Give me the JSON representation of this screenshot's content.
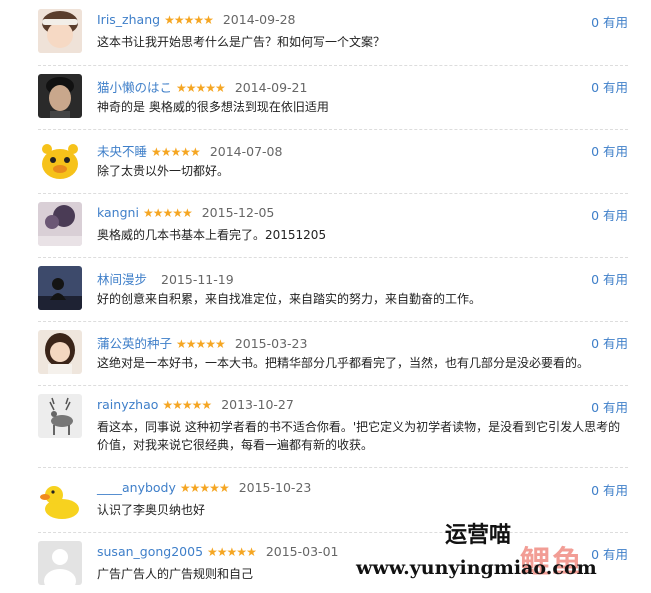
{
  "reviews": [
    {
      "user": "Iris_zhang",
      "stars": "★★★★★",
      "date": "2014-09-28",
      "useful": "0 有用",
      "text": "这本书让我开始思考什么是广告？和如何写一个文案？"
    },
    {
      "user": "猫小懒のはこ",
      "stars": "★★★★★",
      "date": "2014-09-21",
      "useful": "0 有用",
      "text": "神奇的是 奥格威的很多想法到现在依旧适用"
    },
    {
      "user": "未央不睡",
      "stars": "★★★★★",
      "date": "2014-07-08",
      "useful": "0 有用",
      "text": "除了太贵以外一切都好。"
    },
    {
      "user": "kangni",
      "stars": "★★★★★",
      "date": "2015-12-05",
      "useful": "0 有用",
      "text": "奥格威的几本书基本上看完了。20151205"
    },
    {
      "user": "林间漫步",
      "stars": "",
      "date": "2015-11-19",
      "useful": "0 有用",
      "text": "好的创意来自积累，来自找准定位，来自踏实的努力，来自勤奋的工作。"
    },
    {
      "user": "蒲公英的种子",
      "stars": "★★★★★",
      "date": "2015-03-23",
      "useful": "0 有用",
      "text": "这绝对是一本好书，一本大书。把精华部分几乎都看完了，当然，也有几部分是没必要看的。"
    },
    {
      "user": "rainyzhao",
      "stars": "★★★★★",
      "date": "2013-10-27",
      "useful": "0 有用",
      "text": "看这本，同事说 这种初学者看的书不适合你看。'把它定义为初学者读物，是没看到它引发人思考的价值，对我来说它很经典，每看一遍都有新的收获。"
    },
    {
      "user": "____anybody",
      "stars": "★★★★★",
      "date": "2015-10-23",
      "useful": "0 有用",
      "text": "认识了李奥贝纳也好"
    },
    {
      "user": "susan_gong2005",
      "stars": "★★★★★",
      "date": "2015-03-01",
      "useful": "0 有用",
      "text": "广告广告人的广告规则和自己"
    }
  ],
  "watermark": {
    "title": "运营喵",
    "url": "www.yunyingmiao.com",
    "logo": "鲤鱼"
  }
}
